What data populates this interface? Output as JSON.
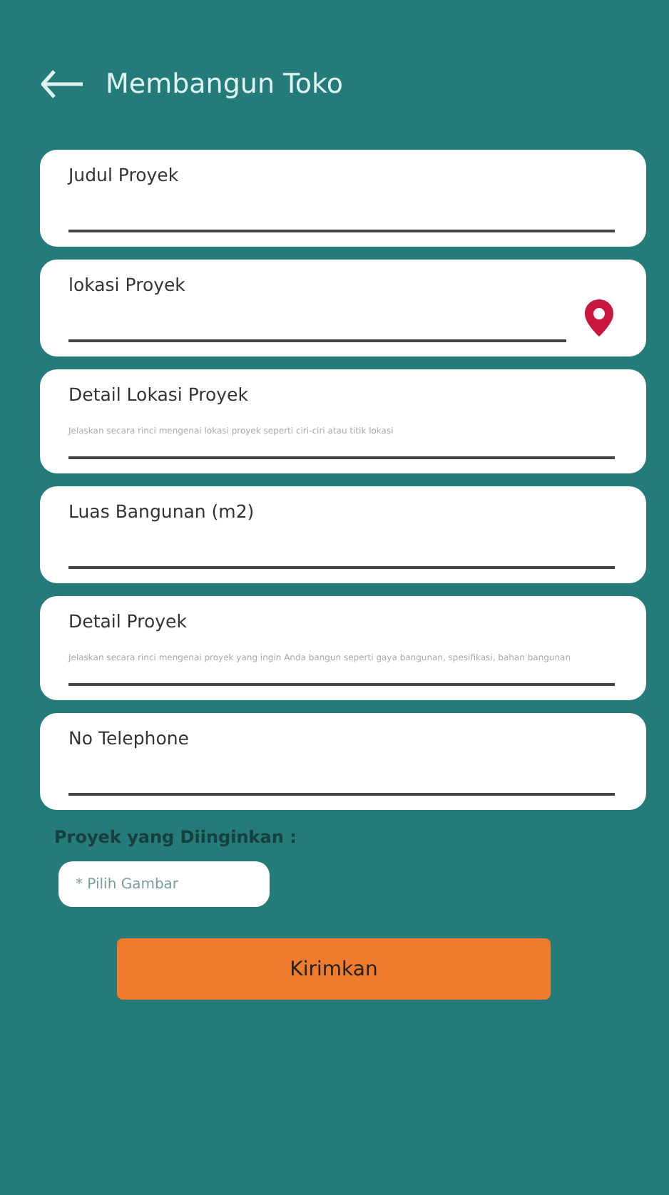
{
  "header": {
    "title": "Membangun Toko"
  },
  "fields": [
    {
      "label": "Judul Proyek",
      "kind": "plain"
    },
    {
      "label": "lokasi Proyek",
      "kind": "location"
    },
    {
      "label": "Detail Lokasi Proyek",
      "kind": "plain",
      "placeholder": "Jelaskan secara rinci mengenai lokasi proyek seperti ciri-ciri atau titik lokasi"
    },
    {
      "label": "Luas Bangunan (m2)",
      "kind": "plain"
    },
    {
      "label": "Detail Proyek",
      "kind": "plain",
      "placeholder": "Jelaskan secara rinci mengenai proyek yang ingin Anda bangun seperti gaya bangunan, spesifikasi, bahan bangunan"
    },
    {
      "label": "No Telephone",
      "kind": "plain"
    }
  ],
  "picker": {
    "label": "Proyek yang Diinginkan :",
    "placeholder": "* Pilih Gambar"
  },
  "submit": "Kirimkan"
}
